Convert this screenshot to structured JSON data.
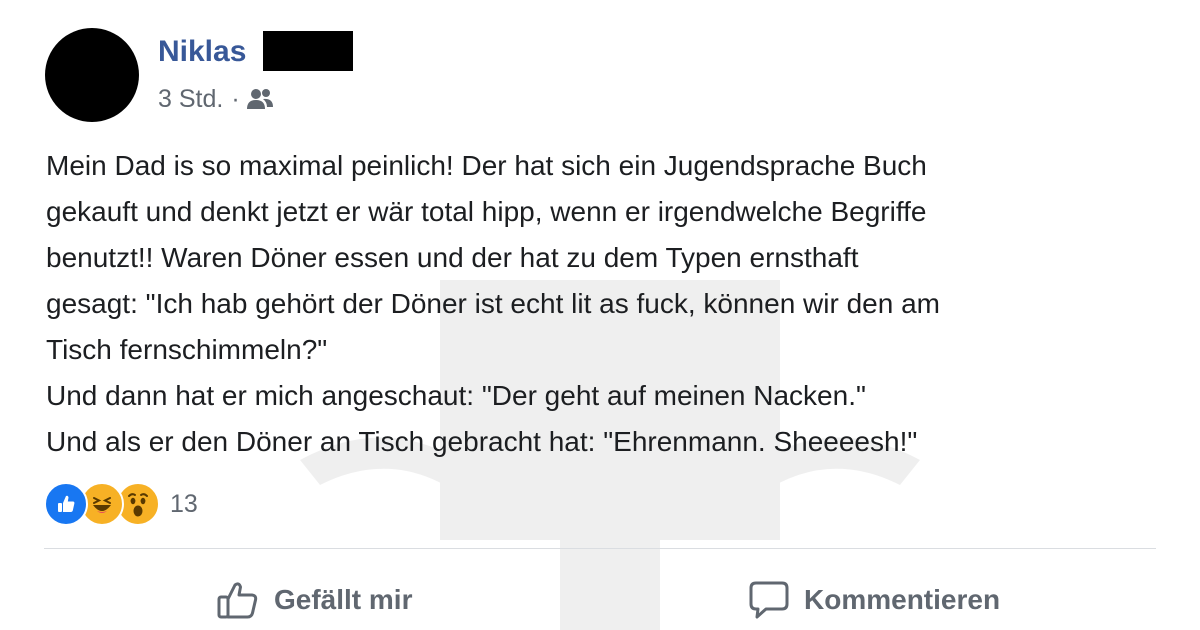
{
  "post": {
    "author_name": "Niklas",
    "timestamp": "3 Std.",
    "meta_separator": "·",
    "audience_icon": "friends-icon",
    "text": "Mein Dad is so maximal peinlich! Der hat sich ein Jugendsprache Buch\ngekauft und denkt jetzt er wär total hipp, wenn er irgendwelche Begriffe\nbenutzt!! Waren Döner essen und der hat zu dem Typen ernsthaft\ngesagt: \"Ich hab gehört der Döner ist echt lit as fuck, können wir den am\nTisch fernschimmeln?\"\nUnd dann hat er mich angeschaut: \"Der geht auf meinen Nacken.\"\nUnd als er den Döner an Tisch gebracht hat: \"Ehrenmann. Sheeeesh!\""
  },
  "reactions": {
    "types": [
      "like",
      "haha",
      "wow"
    ],
    "count": "13"
  },
  "actions": {
    "like_label": "Gefällt mir",
    "like_icon": "thumbs-up-icon",
    "comment_label": "Kommentieren",
    "comment_icon": "speech-bubble-icon"
  },
  "colors": {
    "author_link": "#385898",
    "secondary_text": "#606770",
    "body_text": "#1c1e21",
    "like_blue": "#1877f2",
    "emoji_yellow": "#f7b125",
    "divider": "#dadde1"
  }
}
